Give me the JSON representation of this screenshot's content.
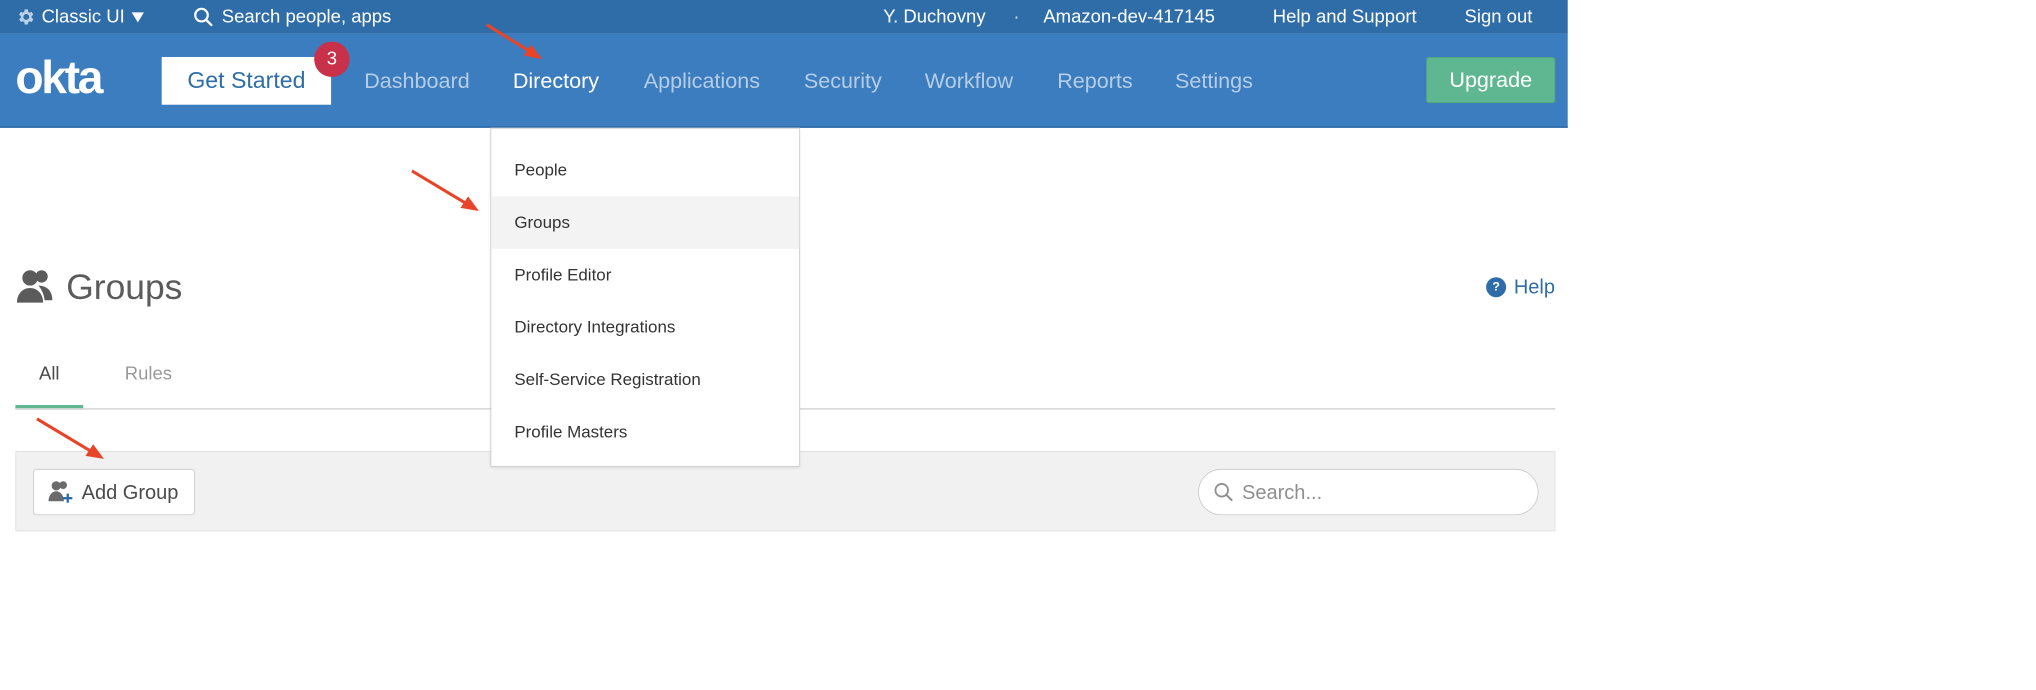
{
  "topbar": {
    "classic_ui": "Classic UI",
    "search_placeholder": "Search people, apps",
    "user_name": "Y. Duchovny",
    "separator": "·",
    "org_name": "Amazon-dev-417145",
    "help_support": "Help and Support",
    "sign_out": "Sign out"
  },
  "nav": {
    "logo": "okta",
    "get_started": "Get Started",
    "badge_count": "3",
    "links": [
      {
        "label": "Dashboard"
      },
      {
        "label": "Directory"
      },
      {
        "label": "Applications"
      },
      {
        "label": "Security"
      },
      {
        "label": "Workflow"
      },
      {
        "label": "Reports"
      },
      {
        "label": "Settings"
      }
    ],
    "active": "Directory",
    "upgrade": "Upgrade"
  },
  "dropdown": {
    "items": [
      {
        "label": "People"
      },
      {
        "label": "Groups"
      },
      {
        "label": "Profile Editor"
      },
      {
        "label": "Directory Integrations"
      },
      {
        "label": "Self-Service Registration"
      },
      {
        "label": "Profile Masters"
      }
    ],
    "highlighted": "Groups"
  },
  "page": {
    "title": "Groups",
    "help": "Help",
    "tabs": [
      {
        "label": "All"
      },
      {
        "label": "Rules"
      }
    ],
    "active_tab": "All",
    "add_group": "Add Group",
    "search_placeholder": "Search..."
  },
  "colors": {
    "topbar": "#2f6da8",
    "nav": "#3b7dbf",
    "upgrade": "#5fb791",
    "badge": "#c9314a",
    "annotation_arrow": "#e8442a"
  },
  "icons": [
    "gear-icon",
    "caret-down-icon",
    "search-icon",
    "groups-icon",
    "help-icon",
    "add-group-icon"
  ]
}
